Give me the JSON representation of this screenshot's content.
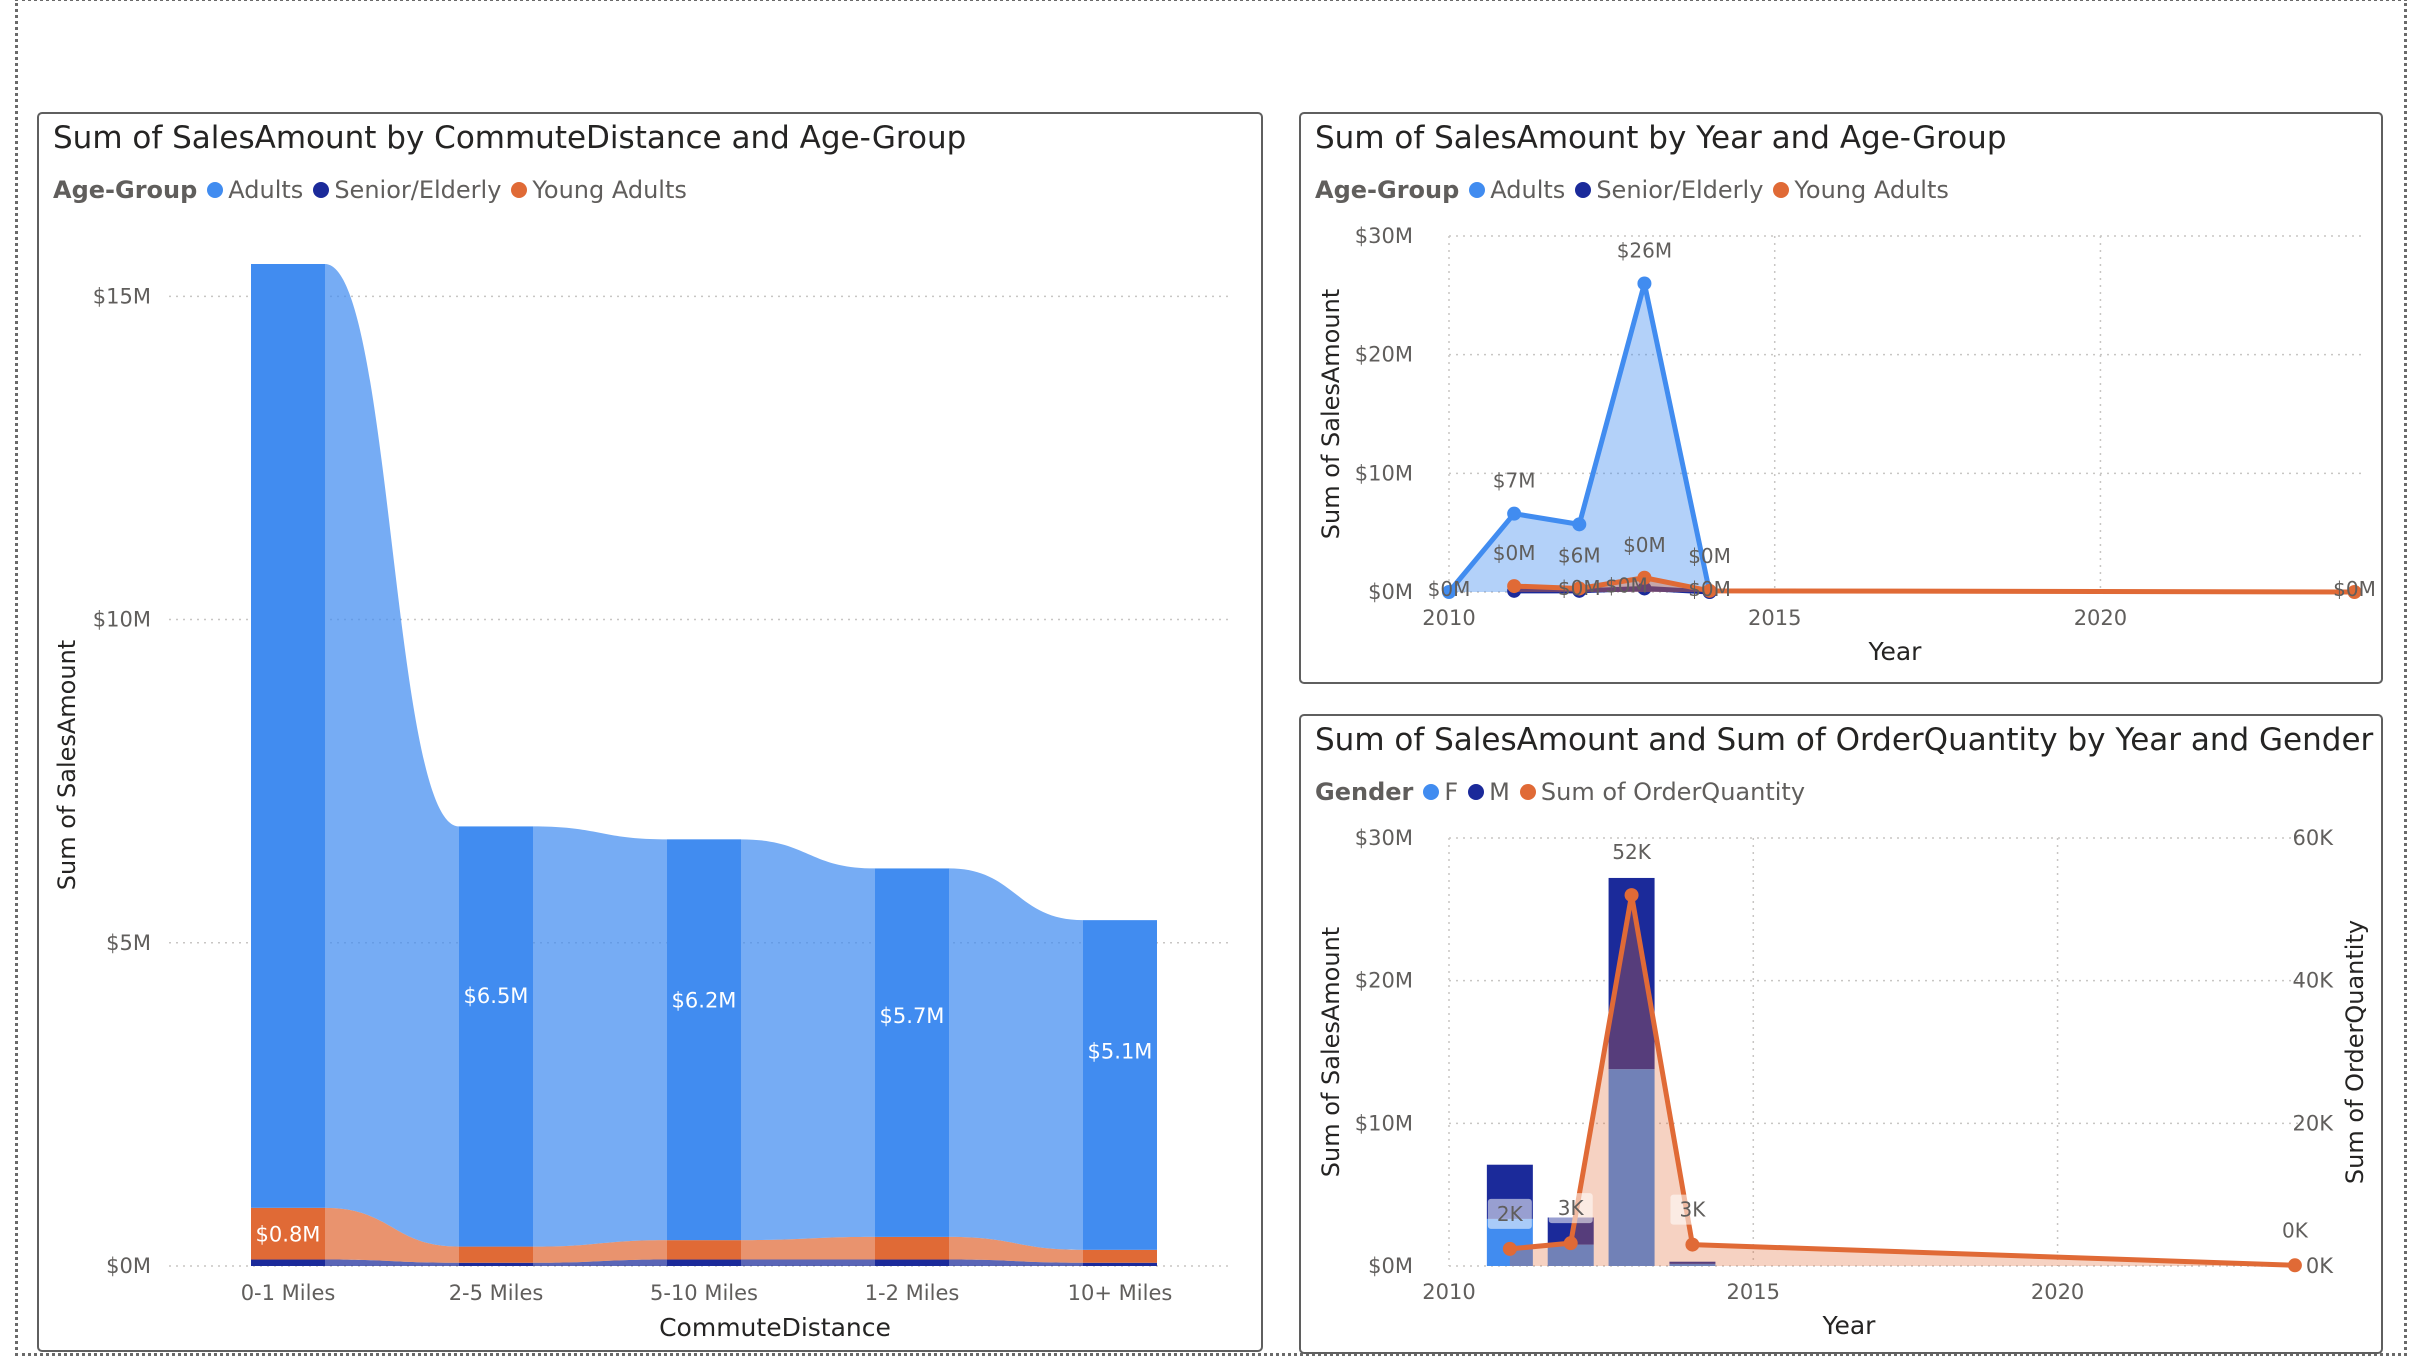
{
  "colors": {
    "adults": "#418cf0",
    "senior": "#1b2a9a",
    "young": "#e06a36",
    "grid": "#c8c6c4",
    "axis_text": "#605e5c",
    "axis_title": "#252423"
  },
  "chart_data": [
    {
      "id": "ribbon",
      "type": "bar",
      "subtype": "ribbon-stacked",
      "title": "Sum of SalesAmount by CommuteDistance and Age-Group",
      "legend": {
        "title": "Age-Group",
        "items": [
          "Adults",
          "Senior/Elderly",
          "Young Adults"
        ]
      },
      "xlabel": "CommuteDistance",
      "ylabel": "Sum of SalesAmount",
      "ylim": [
        0,
        15.5
      ],
      "yticks": [
        {
          "value": 0,
          "label": "$0M"
        },
        {
          "value": 5,
          "label": "$5M"
        },
        {
          "value": 10,
          "label": "$10M"
        },
        {
          "value": 15,
          "label": "$15M"
        }
      ],
      "categories": [
        "0-1 Miles",
        "2-5 Miles",
        "5-10 Miles",
        "1-2 Miles",
        "10+ Miles"
      ],
      "series": [
        {
          "name": "Senior/Elderly",
          "values": [
            0.1,
            0.05,
            0.1,
            0.1,
            0.05
          ]
        },
        {
          "name": "Young Adults",
          "values": [
            0.8,
            0.25,
            0.3,
            0.35,
            0.2
          ]
        },
        {
          "name": "Adults",
          "values": [
            14.6,
            6.5,
            6.2,
            5.7,
            5.1
          ]
        }
      ],
      "data_labels": [
        {
          "series": "Adults",
          "category": "2-5 Miles",
          "text": "$6.5M"
        },
        {
          "series": "Adults",
          "category": "5-10 Miles",
          "text": "$6.2M"
        },
        {
          "series": "Adults",
          "category": "1-2 Miles",
          "text": "$5.7M"
        },
        {
          "series": "Adults",
          "category": "10+ Miles",
          "text": "$5.1M"
        },
        {
          "series": "Young Adults",
          "category": "0-1 Miles",
          "text": "$0.8M"
        }
      ],
      "grid": true,
      "legend_placement": "top-left"
    },
    {
      "id": "area",
      "type": "area",
      "title": "Sum of SalesAmount by Year and Age-Group",
      "legend": {
        "title": "Age-Group",
        "items": [
          "Adults",
          "Senior/Elderly",
          "Young Adults"
        ]
      },
      "xlabel": "Year",
      "ylabel": "Sum of SalesAmount",
      "xlim": [
        2010,
        2024
      ],
      "ylim": [
        0,
        30
      ],
      "xticks": [
        2010,
        2015,
        2020
      ],
      "yticks": [
        {
          "value": 0,
          "label": "$0M"
        },
        {
          "value": 10,
          "label": "$10M"
        },
        {
          "value": 20,
          "label": "$20M"
        },
        {
          "value": 30,
          "label": "$30M"
        }
      ],
      "series": [
        {
          "name": "Adults",
          "x": [
            2010,
            2011,
            2012,
            2013,
            2014
          ],
          "values": [
            0.0,
            6.6,
            5.7,
            26.0,
            0.0
          ]
        },
        {
          "name": "Senior/Elderly",
          "x": [
            2011,
            2012,
            2013,
            2014
          ],
          "values": [
            0.1,
            0.1,
            0.3,
            0.0
          ]
        },
        {
          "name": "Young Adults",
          "x": [
            2011,
            2012,
            2013,
            2014,
            2023.9
          ],
          "values": [
            0.5,
            0.3,
            1.2,
            0.1,
            0.0
          ]
        }
      ],
      "data_labels": [
        {
          "x": 2011,
          "y": 6.6,
          "text": "$7M",
          "dx": 0,
          "dy": -26
        },
        {
          "x": 2012,
          "y": 5.7,
          "text": "$6M",
          "dx": 0,
          "dy": 38
        },
        {
          "x": 2013,
          "y": 26.0,
          "text": "$26M",
          "dx": 0,
          "dy": -26
        },
        {
          "x": 2010,
          "y": 0,
          "text": "$0M",
          "dx": 0,
          "dy": 4
        },
        {
          "x": 2011,
          "y": 0.5,
          "text": "$0M",
          "dx": 0,
          "dy": -26
        },
        {
          "x": 2013,
          "y": 1.2,
          "text": "$0M",
          "dx": 0,
          "dy": -26
        },
        {
          "x": 2014,
          "y": 0.1,
          "text": "$0M",
          "dx": 0,
          "dy": -28
        },
        {
          "x": 2012,
          "y": 0.1,
          "text": "$0M",
          "dx": 0,
          "dy": 4
        },
        {
          "x": 2013,
          "y": 0.3,
          "text": "$0M",
          "dx": -18,
          "dy": 4
        },
        {
          "x": 2014,
          "y": 0,
          "text": "$0M",
          "dx": 0,
          "dy": 4
        },
        {
          "x": 2023.9,
          "y": 0,
          "text": "$0M",
          "dx": 0,
          "dy": 4
        }
      ],
      "grid": true,
      "legend_placement": "top-left"
    },
    {
      "id": "combo",
      "type": "bar",
      "subtype": "stacked-column-with-line",
      "title": "Sum of SalesAmount and Sum of OrderQuantity by Year and Gender",
      "legend": {
        "title": "Gender",
        "items": [
          "F",
          "M",
          "Sum of OrderQuantity"
        ]
      },
      "xlabel": "Year",
      "ylabel": "Sum of SalesAmount",
      "y2label": "Sum of OrderQuantity",
      "xlim": [
        2010,
        2024
      ],
      "ylim": [
        0,
        30
      ],
      "y2lim": [
        0,
        60
      ],
      "xticks": [
        2010,
        2015,
        2020
      ],
      "yticks": [
        {
          "value": 0,
          "label": "$0M"
        },
        {
          "value": 10,
          "label": "$10M"
        },
        {
          "value": 20,
          "label": "$20M"
        },
        {
          "value": 30,
          "label": "$30M"
        }
      ],
      "y2ticks": [
        {
          "value": 0,
          "label": "0K"
        },
        {
          "value": 20,
          "label": "20K"
        },
        {
          "value": 40,
          "label": "40K"
        },
        {
          "value": 60,
          "label": "60K"
        }
      ],
      "x": [
        2011,
        2012,
        2013,
        2014
      ],
      "series": [
        {
          "name": "F",
          "values": [
            3.3,
            1.5,
            13.8,
            0.15
          ]
        },
        {
          "name": "M",
          "values": [
            3.8,
            1.9,
            13.4,
            0.15
          ]
        }
      ],
      "line": {
        "name": "Sum of OrderQuantity",
        "x": [
          2011,
          2012,
          2013,
          2014,
          2023.9
        ],
        "values": [
          2.4,
          3.2,
          52.0,
          3.0,
          0.1
        ],
        "labels": [
          "2K",
          "3K",
          "52K",
          "3K",
          "0K"
        ]
      },
      "grid": true,
      "legend_placement": "top-left"
    }
  ]
}
